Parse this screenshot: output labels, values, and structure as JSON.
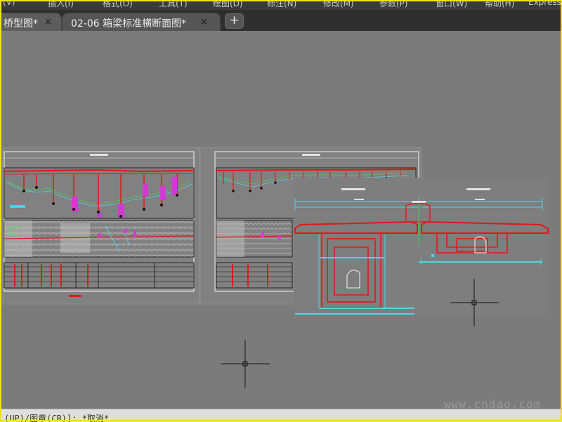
{
  "menu": {
    "items": [
      "(V)",
      "插入(I)",
      "格式(O)",
      "工具(T)",
      "绘图(D)",
      "标注(N)",
      "修改(M)",
      "参数(P)",
      "窗口(W)",
      "帮助(H)",
      "Express"
    ]
  },
  "tabs": [
    {
      "label": "桥型图*",
      "active": true
    },
    {
      "label": "02-06 箱梁标准横断面图*",
      "active": false
    }
  ],
  "tab_add_label": "+",
  "tab_close_glyph": "×",
  "command_line": "(UP)/图章(CR)]: *取消*",
  "watermark": "www.cndao.com",
  "colors": {
    "canvas": "#7b7b7b",
    "tabbar": "#2e2e2e",
    "frame": "#f3e11a"
  }
}
